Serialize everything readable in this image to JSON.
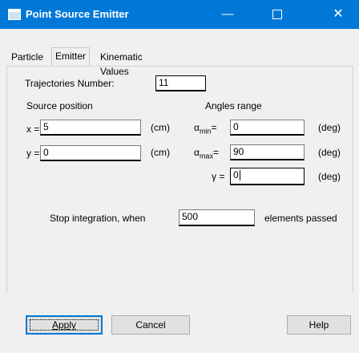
{
  "window": {
    "title": "Point Source Emitter",
    "minimize_glyph": "—",
    "close_glyph": "✕"
  },
  "tabs": [
    "Particle",
    "Emitter",
    "Kinematic Values"
  ],
  "active_tab": "Emitter",
  "trajectories": {
    "label": "Trajectories Number:",
    "value": "11"
  },
  "source_position": {
    "heading": "Source position",
    "x_label": "x =",
    "x_value": "5",
    "y_label": "y =",
    "y_value": "0",
    "unit": "(cm)"
  },
  "angles": {
    "heading": "Angles range",
    "min_label": "α",
    "min_sub": "min",
    "min_value": "0",
    "max_label": "α",
    "max_sub": "max",
    "max_value": "90",
    "gamma_label": "γ =",
    "gamma_value": "0",
    "unit": "(deg)"
  },
  "stop": {
    "label": "Stop integration, when",
    "value": "500",
    "suffix": "elements passed"
  },
  "buttons": {
    "apply": "Apply",
    "cancel": "Cancel",
    "help": "Help"
  }
}
